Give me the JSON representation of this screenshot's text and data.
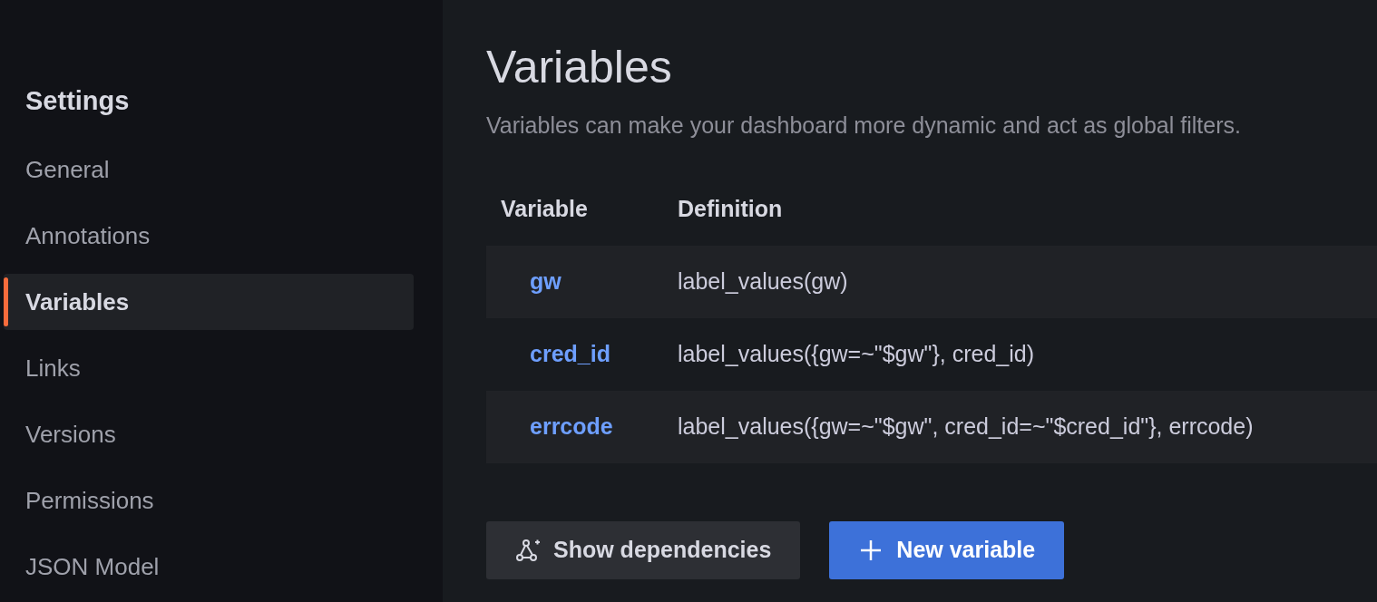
{
  "sidebar": {
    "title": "Settings",
    "items": [
      {
        "label": "General",
        "selected": false
      },
      {
        "label": "Annotations",
        "selected": false
      },
      {
        "label": "Variables",
        "selected": true
      },
      {
        "label": "Links",
        "selected": false
      },
      {
        "label": "Versions",
        "selected": false
      },
      {
        "label": "Permissions",
        "selected": false
      },
      {
        "label": "JSON Model",
        "selected": false
      }
    ]
  },
  "page": {
    "title": "Variables",
    "subtitle": "Variables can make your dashboard more dynamic and act as global filters."
  },
  "table": {
    "columns": [
      "Variable",
      "Definition"
    ],
    "rows": [
      {
        "name": "gw",
        "definition": "label_values(gw)"
      },
      {
        "name": "cred_id",
        "definition": "label_values({gw=~\"$gw\"}, cred_id)"
      },
      {
        "name": "errcode",
        "definition": "label_values({gw=~\"$gw\", cred_id=~\"$cred_id\"}, errcode)"
      }
    ]
  },
  "buttons": [
    {
      "kind": "secondary",
      "label": "Show dependencies"
    },
    {
      "kind": "primary",
      "label": "New variable"
    }
  ]
}
